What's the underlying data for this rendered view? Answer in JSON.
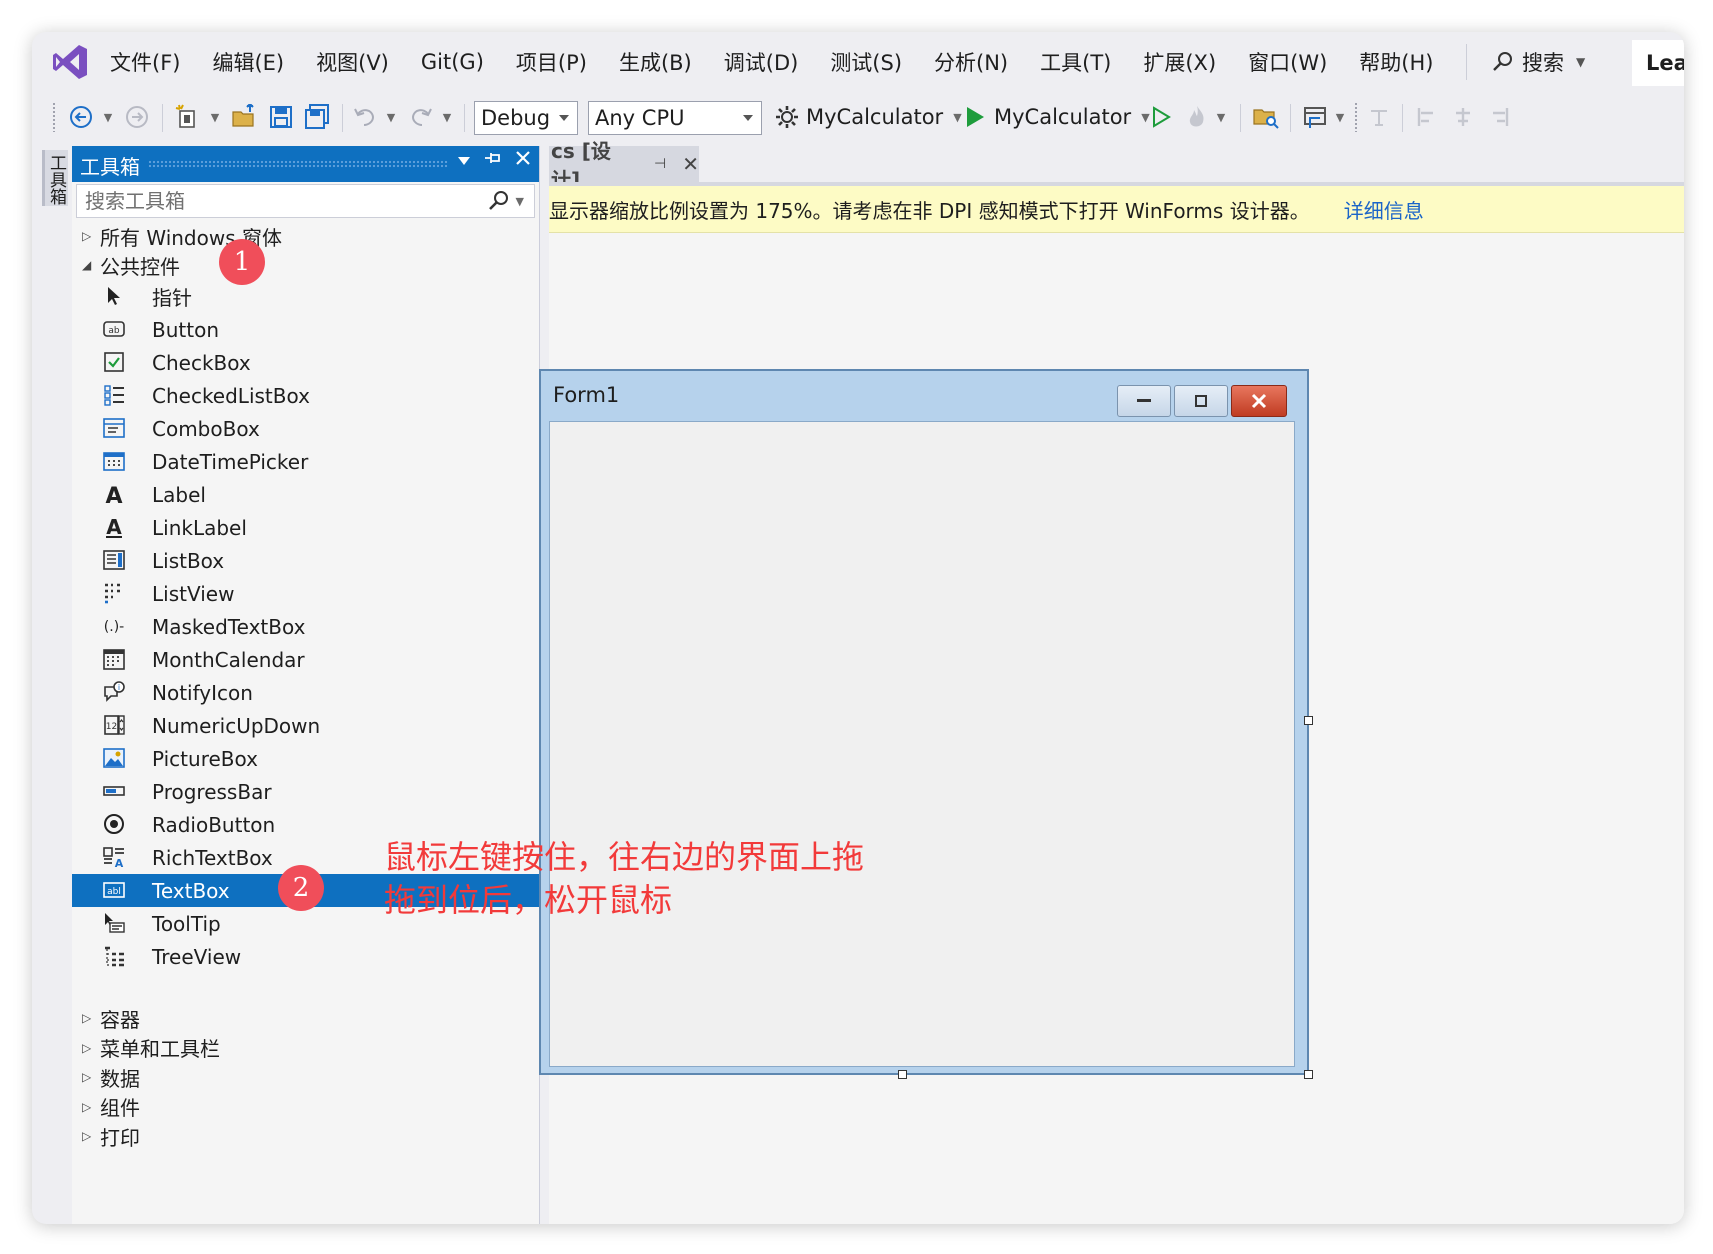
{
  "menu": {
    "items": [
      "文件(F)",
      "编辑(E)",
      "视图(V)",
      "Git(G)",
      "项目(P)",
      "生成(B)",
      "调试(D)",
      "测试(S)",
      "分析(N)",
      "工具(T)",
      "扩展(X)",
      "窗口(W)",
      "帮助(H)"
    ],
    "search_label": "搜索",
    "user_label": "Lea"
  },
  "toolbar": {
    "configuration": "Debug",
    "platform": "Any CPU",
    "startup_project": "MyCalculator",
    "run_target": "MyCalculator"
  },
  "side_tab": {
    "label": "工具箱"
  },
  "toolbox": {
    "title": "工具箱",
    "search_placeholder": "搜索工具箱",
    "category_all_windows": "所有 Windows 窗体",
    "category_common": "公共控件",
    "items": [
      "指针",
      "Button",
      "CheckBox",
      "CheckedListBox",
      "ComboBox",
      "DateTimePicker",
      "Label",
      "LinkLabel",
      "ListBox",
      "ListView",
      "MaskedTextBox",
      "MonthCalendar",
      "NotifyIcon",
      "NumericUpDown",
      "PictureBox",
      "ProgressBar",
      "RadioButton",
      "RichTextBox",
      "TextBox",
      "ToolTip",
      "TreeView"
    ],
    "selected_item": "TextBox",
    "bottom_categories": [
      "容器",
      "菜单和工具栏",
      "数据",
      "组件",
      "打印"
    ]
  },
  "document": {
    "tab_label": "cs [设计]",
    "info_message": "显示器缩放比例设置为 175%。请考虑在非 DPI 感知模式下打开 WinForms 设计器。",
    "info_link": "详细信息",
    "form_title": "Form1"
  },
  "annotations": {
    "badge_1": "1",
    "badge_2": "2",
    "instruction_line1": "鼠标左键按住，往右边的界面上拖",
    "instruction_line2": "拖到位后，松开鼠标"
  },
  "colors": {
    "accent": "#0e70c0",
    "annotation_red": "#f23a3a",
    "badge_red": "#f04e5a",
    "infobar_bg": "#fdfbc5",
    "link": "#1a64c8"
  }
}
